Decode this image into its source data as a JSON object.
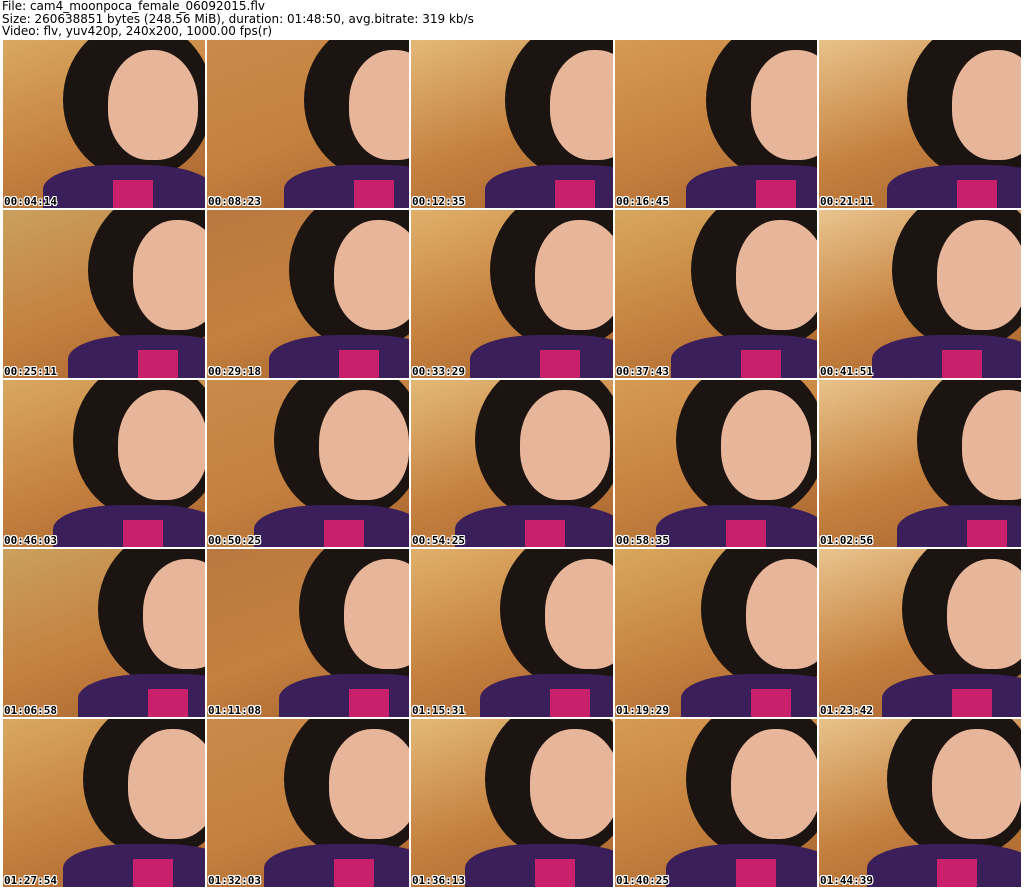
{
  "header": {
    "file_line": "File: cam4_moonpoca_female_06092015.flv",
    "size_line": "Size: 260638851 bytes (248.56 MiB), duration: 01:48:50, avg.bitrate: 319 kb/s",
    "video_line": "Video: flv, yuv420p, 240x200, 1000.00 fps(r)"
  },
  "thumbnails": [
    {
      "time": "00:04:14"
    },
    {
      "time": "00:08:23"
    },
    {
      "time": "00:12:35"
    },
    {
      "time": "00:16:45"
    },
    {
      "time": "00:21:11"
    },
    {
      "time": "00:25:11"
    },
    {
      "time": "00:29:18"
    },
    {
      "time": "00:33:29"
    },
    {
      "time": "00:37:43"
    },
    {
      "time": "00:41:51"
    },
    {
      "time": "00:46:03"
    },
    {
      "time": "00:50:25"
    },
    {
      "time": "00:54:25"
    },
    {
      "time": "00:58:35"
    },
    {
      "time": "01:02:56"
    },
    {
      "time": "01:06:58"
    },
    {
      "time": "01:11:08"
    },
    {
      "time": "01:15:31"
    },
    {
      "time": "01:19:29"
    },
    {
      "time": "01:23:42"
    },
    {
      "time": "01:27:54"
    },
    {
      "time": "01:32:03"
    },
    {
      "time": "01:36:13"
    },
    {
      "time": "01:40:25"
    },
    {
      "time": "01:44:39"
    }
  ]
}
